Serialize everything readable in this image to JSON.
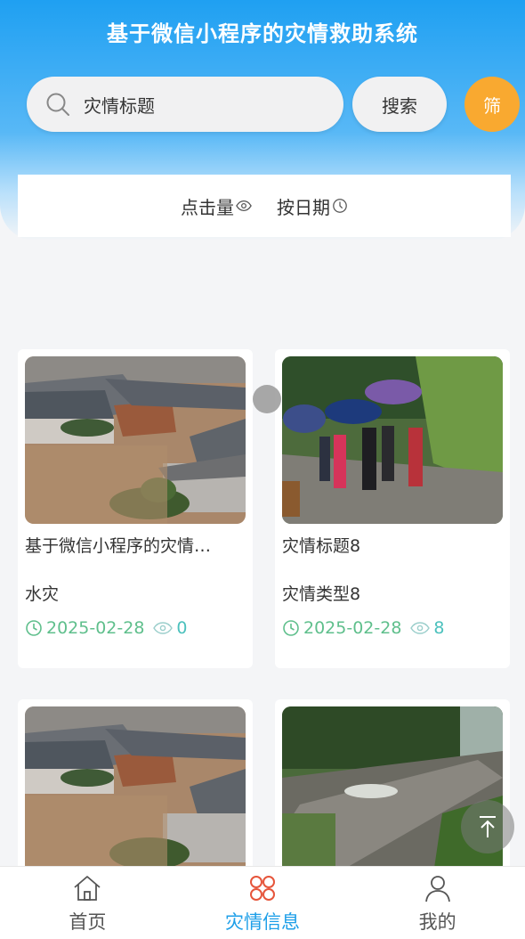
{
  "header": {
    "title": "基于微信小程序的灾情救助系统"
  },
  "search": {
    "value": "灾情标题",
    "button_label": "搜索",
    "filter_label": "筛"
  },
  "sort": {
    "by_views_label": "点击量",
    "by_date_label": "按日期"
  },
  "cards": [
    {
      "title": "基于微信小程序的灾情…",
      "type": "水灾",
      "date": "2025-02-28",
      "views": "0",
      "image": "flood-village-photo"
    },
    {
      "title": "灾情标题8",
      "type": "灾情类型8",
      "date": "2025-02-28",
      "views": "8",
      "image": "people-umbrellas-flood-photo"
    },
    {
      "title": "",
      "type": "",
      "date": "",
      "views": "",
      "image": "flood-village-photo"
    },
    {
      "title": "",
      "type": "",
      "date": "",
      "views": "",
      "image": "flooded-road-photo"
    }
  ],
  "tabbar": {
    "items": [
      {
        "label": "首页",
        "icon": "home-icon",
        "active": false
      },
      {
        "label": "灾情信息",
        "icon": "grid-icon",
        "active": true
      },
      {
        "label": "我的",
        "icon": "user-icon",
        "active": false
      }
    ]
  },
  "colors": {
    "header_blue": "#1fa0f2",
    "filter_orange": "#f9a930",
    "active_tab": "#1e9fe8",
    "date_green": "#5fbf8c",
    "views_teal": "#4cc1bd"
  }
}
